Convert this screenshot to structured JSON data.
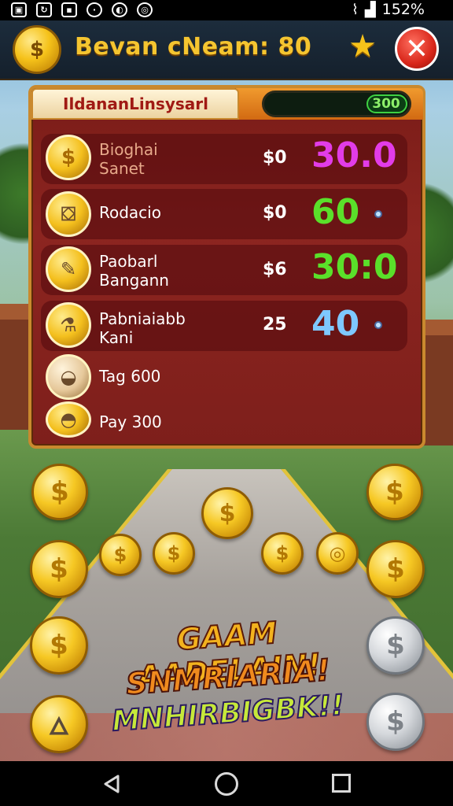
{
  "status_bar": {
    "battery": "152%",
    "icons": [
      "notification-icon",
      "sync-icon",
      "photo-icon",
      "chat-icon",
      "vpn-icon",
      "location-icon"
    ]
  },
  "header": {
    "title": "Bevan cNeam: 80",
    "coin_icon": "coin-pouch-icon",
    "star_icon": "star-icon",
    "close_icon": "close-icon"
  },
  "panel": {
    "title": "IldananLinsysarl",
    "progress_value": "300",
    "rows": [
      {
        "name_line1": "Bioghai",
        "name_line2": "Sanet",
        "price": "$0",
        "amount": "30.0",
        "amount_color": "#e23ce8",
        "icon": "dollar-coin-icon"
      },
      {
        "name_line1": "Rodacio",
        "name_line2": "",
        "price": "$0",
        "amount": "60",
        "amount_color": "#5ae02a",
        "icon": "paint-bucket-icon"
      },
      {
        "name_line1": "Paobarl",
        "name_line2": "Bangann",
        "price": "$6",
        "amount": "30:0",
        "amount_color": "#5ae02a",
        "icon": "spray-can-icon"
      },
      {
        "name_line1": "Pabniaiabb",
        "name_line2": "Kani",
        "price": "25",
        "amount": "40",
        "amount_color": "#7ec8ff",
        "icon": "potion-icon"
      },
      {
        "name_line1": "Tag 600",
        "name_line2": "",
        "price": "",
        "amount": "",
        "amount_color": "",
        "icon": "food-icon"
      },
      {
        "name_line1": "Pay 300",
        "name_line2": "",
        "price": "",
        "amount": "",
        "amount_color": "",
        "icon": "money-bag-icon"
      }
    ]
  },
  "promo": {
    "line1": "GAAM AADELAIN!",
    "line2": "SNMRIARIA!",
    "line3": "MNHIRBIGBK!!"
  },
  "coins": {
    "symbol": "$",
    "torch_icon": "torch-icon",
    "ring_icon": "ring-coin-icon"
  }
}
